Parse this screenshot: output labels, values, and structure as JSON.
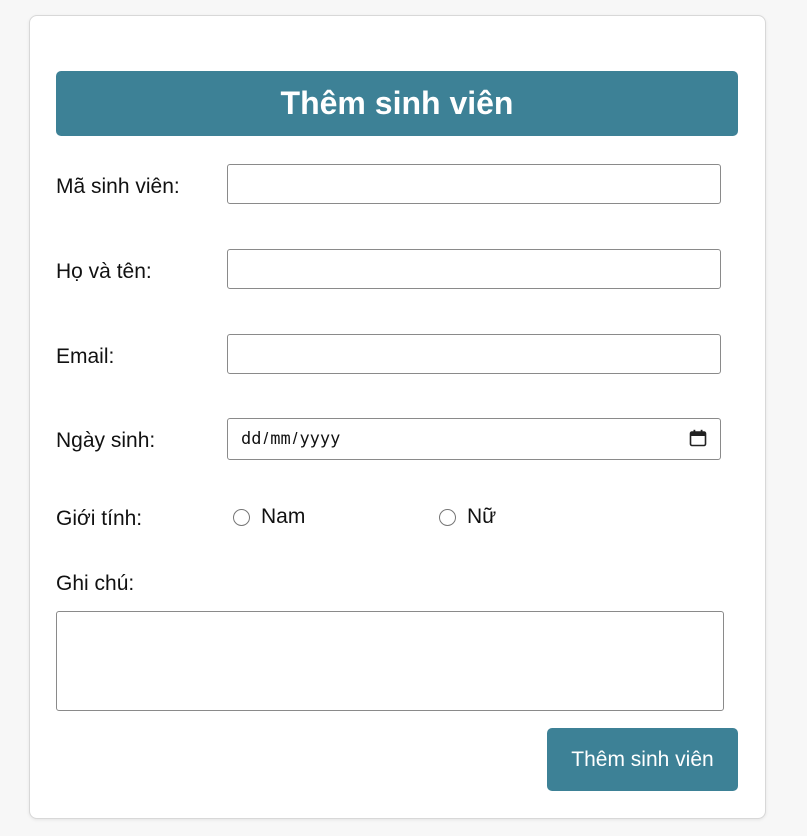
{
  "form": {
    "title": "Thêm sinh viên",
    "fields": {
      "student_id": {
        "label": "Mã sinh viên:",
        "value": ""
      },
      "full_name": {
        "label": "Họ và tên:",
        "value": ""
      },
      "email": {
        "label": "Email:",
        "value": ""
      },
      "birthdate": {
        "label": "Ngày sinh:",
        "day_placeholder": "dd",
        "month_placeholder": "mm",
        "year_placeholder": "yyyy",
        "separator": "/",
        "icon": "calendar-icon"
      },
      "gender": {
        "label": "Giới tính:",
        "options": [
          "Nam",
          "Nữ"
        ],
        "selected": null
      },
      "notes": {
        "label": "Ghi chú:",
        "value": ""
      }
    },
    "submit_label": "Thêm sinh viên"
  },
  "colors": {
    "accent": "#3d8196",
    "background": "#f7f7f7",
    "card": "#ffffff",
    "border": "#8a8a8a"
  }
}
